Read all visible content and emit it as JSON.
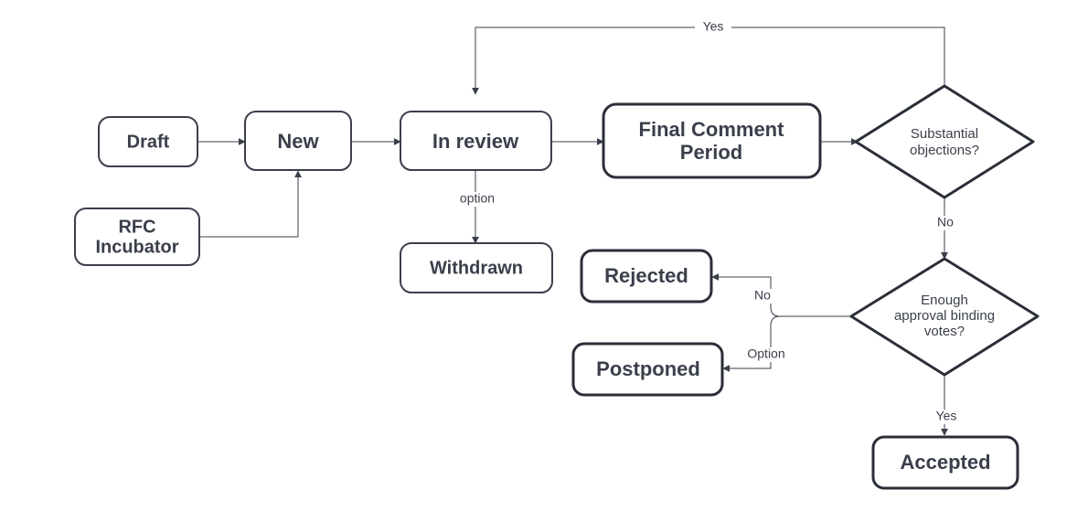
{
  "chart_data": {
    "type": "flowchart",
    "nodes": [
      {
        "id": "draft",
        "label": "Draft",
        "shape": "rect"
      },
      {
        "id": "rfc_incubator",
        "label": "RFC Incubator",
        "shape": "rect"
      },
      {
        "id": "new",
        "label": "New",
        "shape": "rect"
      },
      {
        "id": "in_review",
        "label": "In review",
        "shape": "rect"
      },
      {
        "id": "withdrawn",
        "label": "Withdrawn",
        "shape": "rect"
      },
      {
        "id": "fcp",
        "label": "Final Comment Period",
        "shape": "rect"
      },
      {
        "id": "substantial",
        "label": "Substantial objections?",
        "shape": "diamond"
      },
      {
        "id": "enough_votes",
        "label": "Enough approval binding votes?",
        "shape": "diamond"
      },
      {
        "id": "rejected",
        "label": "Rejected",
        "shape": "rect"
      },
      {
        "id": "postponed",
        "label": "Postponed",
        "shape": "rect"
      },
      {
        "id": "accepted",
        "label": "Accepted",
        "shape": "rect"
      }
    ],
    "edges": [
      {
        "from": "draft",
        "to": "new",
        "label": ""
      },
      {
        "from": "rfc_incubator",
        "to": "new",
        "label": ""
      },
      {
        "from": "new",
        "to": "in_review",
        "label": ""
      },
      {
        "from": "in_review",
        "to": "withdrawn",
        "label": "option"
      },
      {
        "from": "in_review",
        "to": "fcp",
        "label": ""
      },
      {
        "from": "fcp",
        "to": "substantial",
        "label": ""
      },
      {
        "from": "substantial",
        "to": "in_review",
        "label": "Yes"
      },
      {
        "from": "substantial",
        "to": "enough_votes",
        "label": "No"
      },
      {
        "from": "enough_votes",
        "to": "rejected",
        "label": "No"
      },
      {
        "from": "enough_votes",
        "to": "postponed",
        "label": "Option"
      },
      {
        "from": "enough_votes",
        "to": "accepted",
        "label": "Yes"
      }
    ]
  },
  "labels": {
    "draft": "Draft",
    "rfc_incubator_l1": "RFC",
    "rfc_incubator_l2": "Incubator",
    "new": "New",
    "in_review": "In review",
    "withdrawn": "Withdrawn",
    "fcp_l1": "Final Comment",
    "fcp_l2": "Period",
    "substantial_l1": "Substantial",
    "substantial_l2": "objections?",
    "enough_l1": "Enough",
    "enough_l2": "approval binding",
    "enough_l3": "votes?",
    "rejected": "Rejected",
    "postponed": "Postponed",
    "accepted": "Accepted"
  },
  "edge_labels": {
    "option": "option",
    "yes_top": "Yes",
    "no_mid": "No",
    "no_rej": "No",
    "option_post": "Option",
    "yes_acc": "Yes"
  }
}
